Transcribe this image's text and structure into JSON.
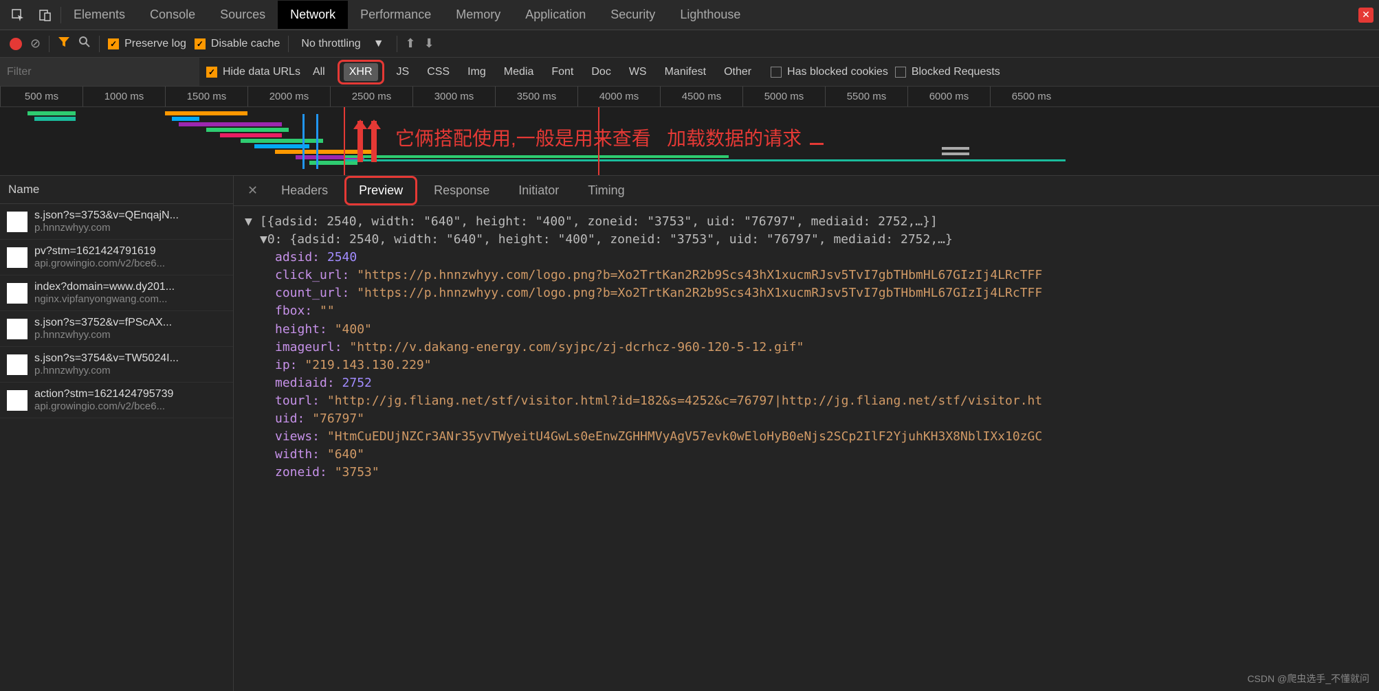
{
  "topTabs": {
    "elements": "Elements",
    "console": "Console",
    "sources": "Sources",
    "network": "Network",
    "performance": "Performance",
    "memory": "Memory",
    "application": "Application",
    "security": "Security",
    "lighthouse": "Lighthouse"
  },
  "toolbar": {
    "preserveLog": "Preserve log",
    "disableCache": "Disable cache",
    "throttling": "No throttling"
  },
  "filter": {
    "placeholder": "Filter",
    "hideDataUrls": "Hide data URLs",
    "all": "All",
    "xhr": "XHR",
    "js": "JS",
    "css": "CSS",
    "img": "Img",
    "media": "Media",
    "font": "Font",
    "doc": "Doc",
    "ws": "WS",
    "manifest": "Manifest",
    "other": "Other",
    "hasBlockedCookies": "Has blocked cookies",
    "blockedRequests": "Blocked Requests"
  },
  "ticks": [
    "500 ms",
    "1000 ms",
    "1500 ms",
    "2000 ms",
    "2500 ms",
    "3000 ms",
    "3500 ms",
    "4000 ms",
    "4500 ms",
    "5000 ms",
    "5500 ms",
    "6000 ms",
    "6500 ms"
  ],
  "annotation": {
    "text1": "它俩搭配使用,一般是用来查看",
    "text2": "加载数据的请求"
  },
  "reqHeader": "Name",
  "requests": [
    {
      "name": "s.json?s=3753&v=QEnqajN...",
      "host": "p.hnnzwhyy.com"
    },
    {
      "name": "pv?stm=1621424791619",
      "host": "api.growingio.com/v2/bce6..."
    },
    {
      "name": "index?domain=www.dy201...",
      "host": "nginx.vipfanyongwang.com..."
    },
    {
      "name": "s.json?s=3752&v=fPScAX...",
      "host": "p.hnnzwhyy.com"
    },
    {
      "name": "s.json?s=3754&v=TW5024I...",
      "host": "p.hnnzwhyy.com"
    },
    {
      "name": "action?stm=1621424795739",
      "host": "api.growingio.com/v2/bce6..."
    }
  ],
  "detailTabs": {
    "headers": "Headers",
    "preview": "Preview",
    "response": "Response",
    "initiator": "Initiator",
    "timing": "Timing"
  },
  "json": {
    "summary": "[{adsid: 2540, width: \"640\", height: \"400\", zoneid: \"3753\", uid: \"76797\", mediaid: 2752,…}]",
    "row0": "0: {adsid: 2540, width: \"640\", height: \"400\", zoneid: \"3753\", uid: \"76797\", mediaid: 2752,…}",
    "fields": {
      "adsid": {
        "k": "adsid:",
        "v": "2540"
      },
      "click_url": {
        "k": "click_url:",
        "v": "\"https://p.hnnzwhyy.com/logo.png?b=Xo2TrtKan2R2b9Scs43hX1xucmRJsv5TvI7gbTHbmHL67GIzIj4LRcTFF"
      },
      "count_url": {
        "k": "count_url:",
        "v": "\"https://p.hnnzwhyy.com/logo.png?b=Xo2TrtKan2R2b9Scs43hX1xucmRJsv5TvI7gbTHbmHL67GIzIj4LRcTFF"
      },
      "fbox": {
        "k": "fbox:",
        "v": "\"\""
      },
      "height": {
        "k": "height:",
        "v": "\"400\""
      },
      "imageurl": {
        "k": "imageurl:",
        "v": "\"http://v.dakang-energy.com/syjpc/zj-dcrhcz-960-120-5-12.gif\""
      },
      "ip": {
        "k": "ip:",
        "v": "\"219.143.130.229\""
      },
      "mediaid": {
        "k": "mediaid:",
        "v": "2752"
      },
      "tourl": {
        "k": "tourl:",
        "v": "\"http://jg.fliang.net/stf/visitor.html?id=182&s=4252&c=76797|http://jg.fliang.net/stf/visitor.ht"
      },
      "uid": {
        "k": "uid:",
        "v": "\"76797\""
      },
      "views": {
        "k": "views:",
        "v": "\"HtmCuEDUjNZCr3ANr35yvTWyeitU4GwLs0eEnwZGHHMVyAgV57evk0wEloHyB0eNjs2SCp2IlF2YjuhKH3X8NblIXx10zGC"
      },
      "width": {
        "k": "width:",
        "v": "\"640\""
      },
      "zoneid": {
        "k": "zoneid:",
        "v": "\"3753\""
      }
    }
  },
  "watermark": "CSDN @爬虫选手_不懂就问"
}
